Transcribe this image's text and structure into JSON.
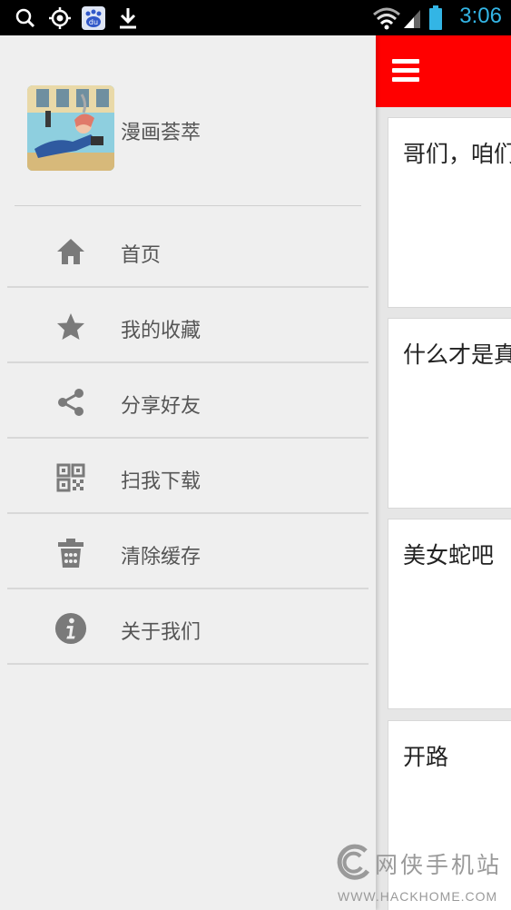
{
  "status_bar": {
    "time": "3:06",
    "icons": [
      "search-icon",
      "gps-icon",
      "baidu-icon",
      "download-icon",
      "wifi-icon",
      "signal-icon",
      "battery-icon"
    ]
  },
  "drawer": {
    "app_name": "漫画荟萃",
    "items": [
      {
        "label": "首页",
        "icon": "home-icon"
      },
      {
        "label": "我的收藏",
        "icon": "star-icon"
      },
      {
        "label": "分享好友",
        "icon": "share-icon"
      },
      {
        "label": "扫我下载",
        "icon": "qr-code-icon"
      },
      {
        "label": "清除缓存",
        "icon": "trash-icon"
      },
      {
        "label": "关于我们",
        "icon": "info-icon"
      }
    ]
  },
  "main": {
    "toolbar_color": "#ff0000",
    "cards": [
      {
        "title": "哥们，咱们"
      },
      {
        "title": "什么才是真"
      },
      {
        "title": "美女蛇吧"
      },
      {
        "title": "开路"
      }
    ]
  },
  "watermark": {
    "brand": "网侠手机站",
    "url": "WWW.HACKHOME.COM"
  }
}
